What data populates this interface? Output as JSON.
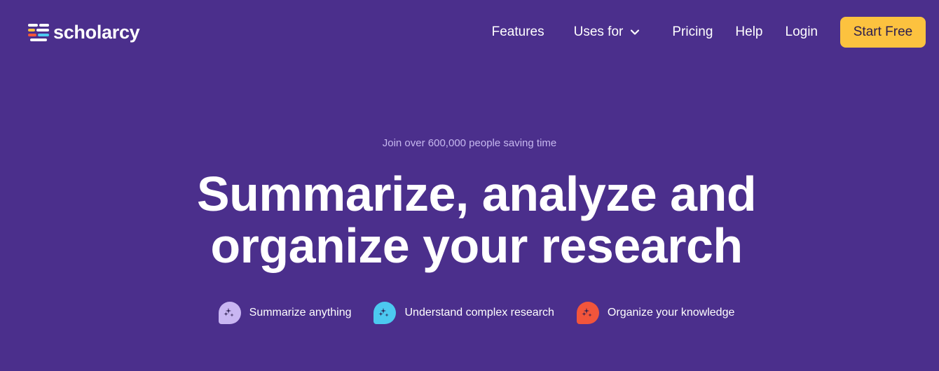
{
  "brand": {
    "name": "scholarcy"
  },
  "nav": {
    "features": "Features",
    "uses_for": "Uses for",
    "pricing": "Pricing",
    "help": "Help",
    "login": "Login",
    "cta": "Start Free"
  },
  "hero": {
    "eyebrow": "Join over 600,000 people saving time",
    "headline_line1": "Summarize, analyze and",
    "headline_line2": "organize your research"
  },
  "features": [
    {
      "label": "Summarize anything",
      "icon": "sparkle-bubble-icon",
      "color": "#c9b6f2"
    },
    {
      "label": "Understand complex research",
      "icon": "sparkle-bubble-icon",
      "color": "#4cc9f0"
    },
    {
      "label": "Organize your knowledge",
      "icon": "sparkle-bubble-icon",
      "color": "#f2553b"
    }
  ],
  "colors": {
    "background": "#4b2f8c",
    "cta": "#fcc23f",
    "eyebrow": "#c6b8ef"
  }
}
